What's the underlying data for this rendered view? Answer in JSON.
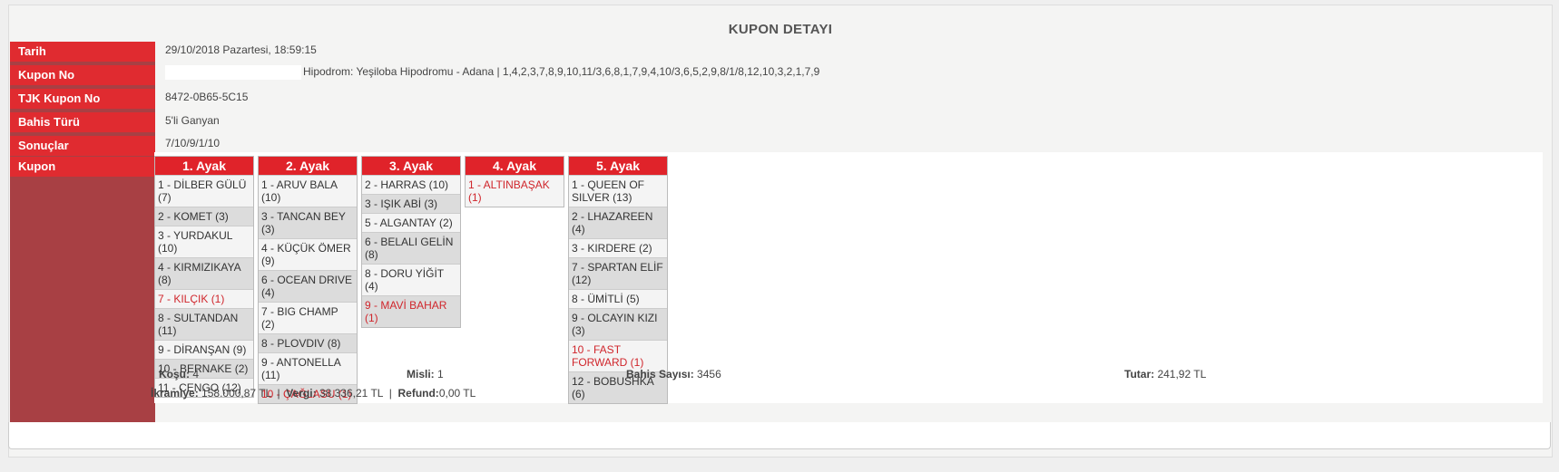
{
  "title": "KUPON DETAYI",
  "labels": {
    "tarih": "Tarih",
    "kupon_no": "Kupon No",
    "tjk_kupon_no": "TJK Kupon No",
    "bahis_turu": "Bahis Türü",
    "sonuclar": "Sonuçlar",
    "kupon": "Kupon"
  },
  "values": {
    "tarih": "29/10/2018 Pazartesi, 18:59:15",
    "kupon_no": "Hipodrom: Yeşiloba Hipodromu - Adana  |  1,4,2,3,7,8,9,10,11/3,6,8,1,7,9,4,10/3,6,5,2,9,8/1/8,12,10,3,2,1,7,9",
    "tjk_kupon_no": "8472-0B65-5C15",
    "bahis_turu": "5'li Ganyan",
    "sonuclar": "7/10/9/1/10"
  },
  "legs": [
    {
      "header": "1. Ayak",
      "items": [
        {
          "text": "1 - DİLBER GÜLÜ (7)",
          "winner": false
        },
        {
          "text": "2 - KOMET (3)",
          "winner": false
        },
        {
          "text": "3 - YURDAKUL (10)",
          "winner": false
        },
        {
          "text": "4 - KIRMIZIKAYA (8)",
          "winner": false
        },
        {
          "text": "7 - KILÇIK (1)",
          "winner": true
        },
        {
          "text": "8 - SULTANDAN (11)",
          "winner": false
        },
        {
          "text": "9 - DİRANŞAN (9)",
          "winner": false
        },
        {
          "text": "10 - BERNAKE (2)",
          "winner": false
        },
        {
          "text": "11 - CENGO (12)",
          "winner": false
        }
      ]
    },
    {
      "header": "2. Ayak",
      "items": [
        {
          "text": "1 - ARUV BALA (10)",
          "winner": false
        },
        {
          "text": "3 - TANCAN BEY (3)",
          "winner": false
        },
        {
          "text": "4 - KÜÇÜK ÖMER (9)",
          "winner": false
        },
        {
          "text": "6 - OCEAN DRIVE (4)",
          "winner": false
        },
        {
          "text": "7 - BIG CHAMP (2)",
          "winner": false
        },
        {
          "text": "8 - PLOVDIV (8)",
          "winner": false
        },
        {
          "text": "9 - ANTONELLA (11)",
          "winner": false
        },
        {
          "text": "10 - ÇAĞLASU (1)",
          "winner": true
        }
      ]
    },
    {
      "header": "3. Ayak",
      "items": [
        {
          "text": "2 - HARRAS (10)",
          "winner": false
        },
        {
          "text": "3 - IŞIK ABİ (3)",
          "winner": false
        },
        {
          "text": "5 - ALGANTAY (2)",
          "winner": false
        },
        {
          "text": "6 - BELALI GELİN (8)",
          "winner": false
        },
        {
          "text": "8 - DORU YİĞİT (4)",
          "winner": false
        },
        {
          "text": "9 - MAVİ BAHAR (1)",
          "winner": true
        }
      ]
    },
    {
      "header": "4. Ayak",
      "items": [
        {
          "text": "1 - ALTINBAŞAK (1)",
          "winner": true
        }
      ]
    },
    {
      "header": "5. Ayak",
      "items": [
        {
          "text": "1 - QUEEN OF SILVER (13)",
          "winner": false
        },
        {
          "text": "2 - LHAZAREEN (4)",
          "winner": false
        },
        {
          "text": "3 - KIRDERE (2)",
          "winner": false
        },
        {
          "text": "7 - SPARTAN ELİF (12)",
          "winner": false
        },
        {
          "text": "8 - ÜMİTLİ (5)",
          "winner": false
        },
        {
          "text": "9 - OLCAYIN KIZI (3)",
          "winner": false
        },
        {
          "text": "10 - FAST FORWARD (1)",
          "winner": true
        },
        {
          "text": "12 - BOBUSHKA (6)",
          "winner": false
        }
      ]
    }
  ],
  "summary": {
    "kosu_label": "Koşu:",
    "kosu_value": "4",
    "misli_label": "Misli:",
    "misli_value": "1",
    "bahis_sayisi_label": "Bahis Sayısı:",
    "bahis_sayisi_value": "3456",
    "tutar_label": "Tutar:",
    "tutar_value": "241,92 TL"
  },
  "totals": {
    "ikramiye_label": "İkramiye:",
    "ikramiye_value": "158.000,87 TL",
    "vergi_label": "Vergi:",
    "vergi_value": "38.336,21 TL",
    "refund_label": "Refund:",
    "refund_value": "0,00 TL",
    "separator": "|"
  },
  "colors": {
    "accent_red": "#e0232a",
    "sidebar_dark": "#a84044",
    "winner_text": "#d0262c"
  }
}
